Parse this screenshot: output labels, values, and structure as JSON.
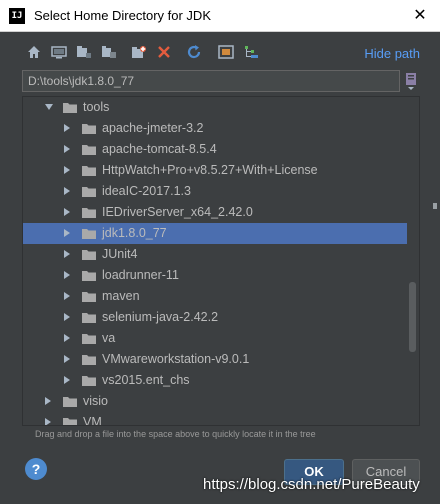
{
  "window": {
    "app_icon_text": "IJ",
    "title": "Select Home Directory for JDK",
    "close_glyph": "✕"
  },
  "toolbar": {
    "icons": [
      "home-icon",
      "desktop-icon",
      "project-icon",
      "module-icon",
      "new-folder-icon",
      "delete-icon",
      "refresh-icon",
      "show-hidden-icon",
      "tree-expand-icon"
    ],
    "hide_path_label": "Hide path"
  },
  "path_field": {
    "value": "D:\\tools\\jdk1.8.0_77"
  },
  "tree": {
    "items": [
      {
        "label": "tools",
        "expanded": true,
        "level": 1
      },
      {
        "label": "apache-jmeter-3.2",
        "expanded": false,
        "level": 2
      },
      {
        "label": "apache-tomcat-8.5.4",
        "expanded": false,
        "level": 2
      },
      {
        "label": "HttpWatch+Pro+v8.5.27+With+License",
        "expanded": false,
        "level": 2
      },
      {
        "label": "ideaIC-2017.1.3",
        "expanded": false,
        "level": 2
      },
      {
        "label": "IEDriverServer_x64_2.42.0",
        "expanded": false,
        "level": 2
      },
      {
        "label": "jdk1.8.0_77",
        "expanded": false,
        "level": 2,
        "selected": true
      },
      {
        "label": "JUnit4",
        "expanded": false,
        "level": 2
      },
      {
        "label": "loadrunner-11",
        "expanded": false,
        "level": 2
      },
      {
        "label": "maven",
        "expanded": false,
        "level": 2
      },
      {
        "label": "selenium-java-2.42.2",
        "expanded": false,
        "level": 2
      },
      {
        "label": "va",
        "expanded": false,
        "level": 2
      },
      {
        "label": "VMwareworkstation-v9.0.1",
        "expanded": false,
        "level": 2
      },
      {
        "label": "vs2015.ent_chs",
        "expanded": false,
        "level": 2
      },
      {
        "label": "visio",
        "expanded": false,
        "level": 1
      },
      {
        "label": "VM",
        "expanded": false,
        "level": 1
      }
    ]
  },
  "hint": "Drag and drop a file into the space above to quickly locate it in the tree",
  "buttons": {
    "help": "?",
    "ok": "OK",
    "cancel": "Cancel"
  },
  "watermark": "https://blog.csdn.net/PureBeauty",
  "colors": {
    "background": "#3c3f41",
    "selection": "#4b6eaf",
    "link": "#589df6",
    "folder": "#a9a9a9"
  }
}
